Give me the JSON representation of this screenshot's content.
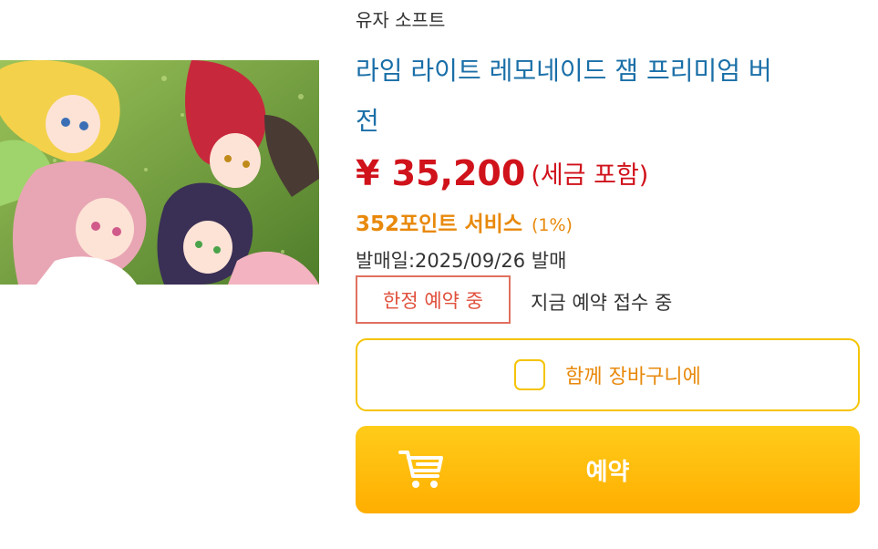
{
  "product": {
    "maker": "유자 소프트",
    "title_line1": "라임 라이트 레모네이드 잼 프리미엄 버",
    "title_line2": "전",
    "price": "¥ 35,200",
    "tax_note": "(세금 포함)",
    "points": "352포인트 서비스",
    "points_rate": "(1%)",
    "release": "발매일:2025/09/26 발매"
  },
  "status": {
    "badge": "한정 예약 중",
    "note": "지금 예약 접수 중"
  },
  "actions": {
    "add_together_label": "함께 장바구니에",
    "reserve_label": "예약"
  },
  "colors": {
    "title": "#1a6fa8",
    "price": "#d0121b",
    "points": "#e8890c",
    "button": "#ffb400"
  },
  "icons": {
    "cart": "cart-icon",
    "checkbox": "checkbox-icon"
  }
}
